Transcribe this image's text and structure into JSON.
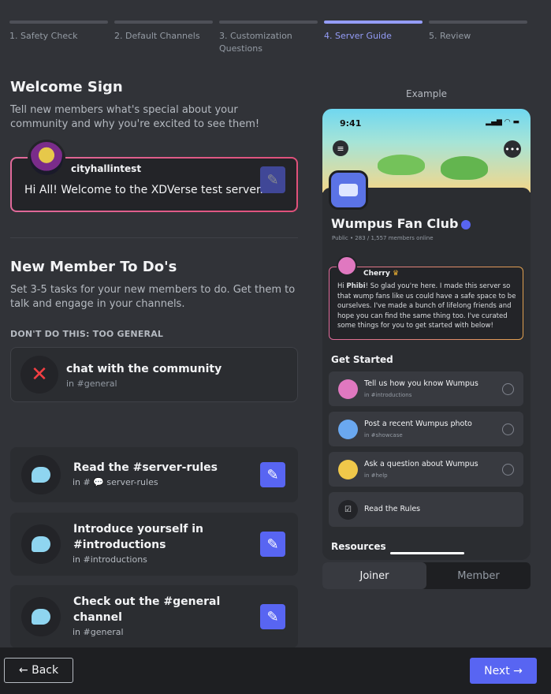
{
  "steps": [
    {
      "label": "1. Safety Check"
    },
    {
      "label": "2. Default Channels"
    },
    {
      "label": "3. Customization Questions"
    },
    {
      "label": "4. Server Guide"
    },
    {
      "label": "5. Review"
    }
  ],
  "welcome": {
    "title": "Welcome Sign",
    "description": "Tell new members what's special about your community and why you're excited to see them!",
    "username": "cityhallintest",
    "message": "Hi All! Welcome to the XDVerse test server."
  },
  "todos": {
    "title": "New Member To Do's",
    "description": "Set 3-5 tasks for your new members to do. Get them to talk and engage in your channels.",
    "bad_example_label": "DON'T DO THIS: TOO GENERAL",
    "bad_example": {
      "title": "chat with the community",
      "sub": "in #general"
    },
    "items": [
      {
        "title": "Read the #server-rules",
        "sub": "in # 💬 server-rules"
      },
      {
        "title": "Introduce yourself in #introductions",
        "sub": "in #introductions"
      },
      {
        "title": "Check out the #general channel",
        "sub": "in #general"
      }
    ]
  },
  "example": {
    "label": "Example",
    "time": "9:41",
    "server_name": "Wumpus Fan Club",
    "server_meta": "Public • 283 / 1,557 members online",
    "welcome_name": "Cherry",
    "welcome_text_prefix": "Hi ",
    "welcome_text_name": "Phibi",
    "welcome_text": "! So glad you're here. I made this server so that wump fans like us could have a safe space to be ourselves. I've made a bunch of lifelong friends and hope you can find the same thing too. I've curated some things for you to get started with below!",
    "get_started": "Get Started",
    "items": [
      {
        "title": "Tell us how you know Wumpus",
        "sub": "in #introductions"
      },
      {
        "title": "Post a recent Wumpus photo",
        "sub": "in #showcase"
      },
      {
        "title": "Ask a question about Wumpus",
        "sub": "in #help"
      },
      {
        "title": "Read the Rules",
        "sub": ""
      }
    ],
    "resources": "Resources"
  },
  "toggle": {
    "joiner": "Joiner",
    "member": "Member"
  },
  "footer": {
    "back": "← Back",
    "next": "Next →"
  },
  "colors": {
    "accent": "#5865f2",
    "active_step": "#949cf7",
    "danger": "#f23f43"
  }
}
